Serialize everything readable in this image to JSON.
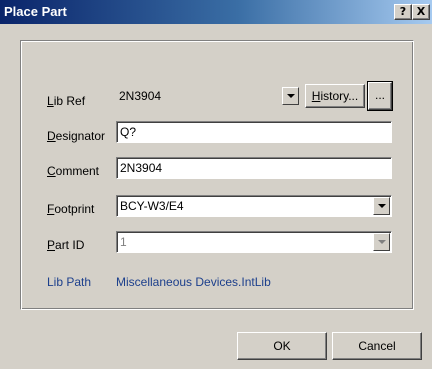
{
  "dialog": {
    "title": "Place Part",
    "help_label": "?",
    "close_label": "X"
  },
  "fields": {
    "lib_ref": {
      "label_u": "L",
      "label_rest": "ib Ref",
      "value": "2N3904"
    },
    "designator": {
      "label_u": "D",
      "label_rest": "esignator",
      "value": "Q?"
    },
    "comment": {
      "label_u": "C",
      "label_rest": "omment",
      "value": "2N3904"
    },
    "footprint": {
      "label_u": "F",
      "label_rest": "ootprint",
      "value": "BCY-W3/E4"
    },
    "part_id": {
      "label_u": "P",
      "label_rest": "art ID",
      "value": "1",
      "disabled": true
    },
    "lib_path": {
      "label": "Lib Path",
      "value": "Miscellaneous Devices.IntLib"
    }
  },
  "buttons": {
    "history_u": "H",
    "history_rest": "istory...",
    "browse": "...",
    "ok": "OK",
    "cancel": "Cancel"
  },
  "colors": {
    "title_bar": "#0a246a",
    "dialog_face": "#d4d0c8",
    "lib_path_text": "#1c3f8c",
    "disabled_text": "#808080"
  }
}
